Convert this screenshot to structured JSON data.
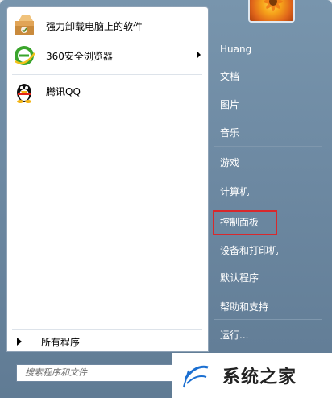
{
  "left": {
    "pinned": [
      {
        "label": "强力卸载电脑上的软件",
        "icon": "uninstaller-box-icon",
        "has_arrow": false
      },
      {
        "label": "360安全浏览器",
        "icon": "360-browser-icon",
        "has_arrow": true
      },
      {
        "label": "腾讯QQ",
        "icon": "qq-penguin-icon",
        "has_arrow": false
      }
    ],
    "all_programs": "所有程序",
    "search_placeholder": "搜索程序和文件"
  },
  "right": {
    "items": [
      {
        "label": "Huang",
        "name": "user-name"
      },
      {
        "label": "文档",
        "name": "documents"
      },
      {
        "label": "图片",
        "name": "pictures"
      },
      {
        "label": "音乐",
        "name": "music"
      },
      {
        "label": "游戏",
        "name": "games"
      },
      {
        "label": "计算机",
        "name": "computer"
      },
      {
        "label": "控制面板",
        "name": "control-panel"
      },
      {
        "label": "设备和打印机",
        "name": "devices-printers"
      },
      {
        "label": "默认程序",
        "name": "default-programs"
      },
      {
        "label": "帮助和支持",
        "name": "help-support"
      },
      {
        "label": "运行...",
        "name": "run"
      }
    ],
    "highlight_color": "#d8282c"
  },
  "watermark": {
    "text": "系统之家"
  }
}
